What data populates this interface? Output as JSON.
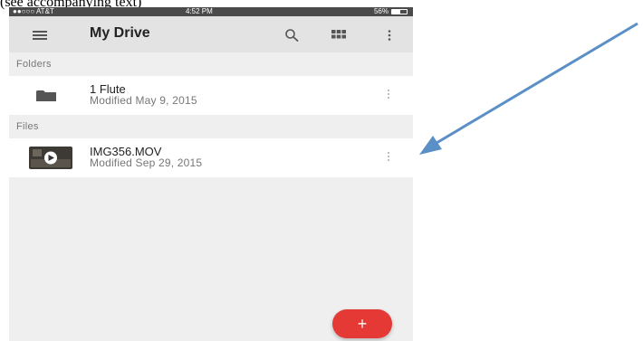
{
  "caption": "(see accompanying text)",
  "status_bar": {
    "carrier": "●●○○○ AT&T",
    "time": "4:52 PM",
    "battery": "56%",
    "battery_level": 0.56
  },
  "app_bar": {
    "title": "My Drive",
    "icons": [
      "menu-icon",
      "search-icon",
      "grid-view-icon",
      "more-vert-icon"
    ]
  },
  "sections": {
    "folders_label": "Folders",
    "files_label": "Files"
  },
  "folders": [
    {
      "name": "1 Flute",
      "modified": "Modified May 9, 2015"
    }
  ],
  "files": [
    {
      "name": "IMG356.MOV",
      "modified": "Modified Sep 29, 2015"
    }
  ],
  "fab": {
    "label": "+",
    "color": "#e53935"
  },
  "annotation_arrow": {
    "color": "#5b8fc7"
  }
}
